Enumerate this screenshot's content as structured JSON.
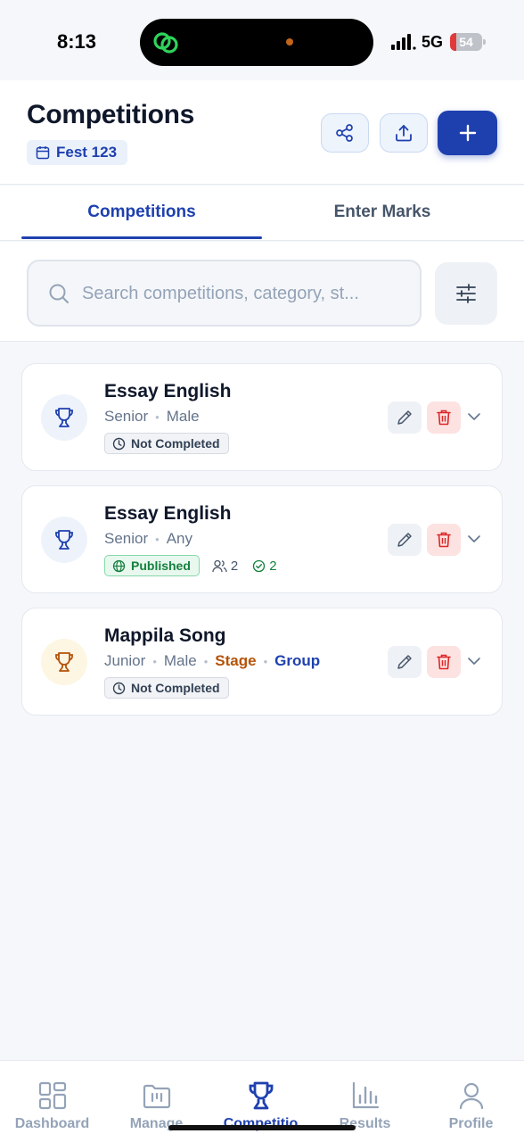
{
  "status_bar": {
    "time": "8:13",
    "network": "5G",
    "battery": "54"
  },
  "header": {
    "title": "Competitions",
    "fest": "Fest 123"
  },
  "tabs": [
    {
      "label": "Competitions",
      "active": true
    },
    {
      "label": "Enter Marks",
      "active": false
    }
  ],
  "search": {
    "placeholder": "Search competitions, category, st..."
  },
  "competitions": [
    {
      "name": "Essay English",
      "category": "Senior",
      "gender": "Male",
      "status": "Not Completed"
    },
    {
      "name": "Essay English",
      "category": "Senior",
      "gender": "Any",
      "status": "Published",
      "participants": "2",
      "completed": "2"
    },
    {
      "name": "Mappila Song",
      "category": "Junior",
      "gender": "Male",
      "type": "Stage",
      "mode": "Group",
      "status": "Not Completed"
    }
  ],
  "nav": [
    {
      "label": "Dashboard",
      "icon": "dashboard-icon"
    },
    {
      "label": "Manage",
      "icon": "folder-icon"
    },
    {
      "label": "Competitio",
      "icon": "trophy-icon",
      "active": true
    },
    {
      "label": "Results",
      "icon": "bar-chart-icon"
    },
    {
      "label": "Profile",
      "icon": "user-icon"
    }
  ],
  "colors": {
    "primary": "#1e40af",
    "danger": "#dc2626",
    "success": "#15803d",
    "stage": "#b45309"
  }
}
